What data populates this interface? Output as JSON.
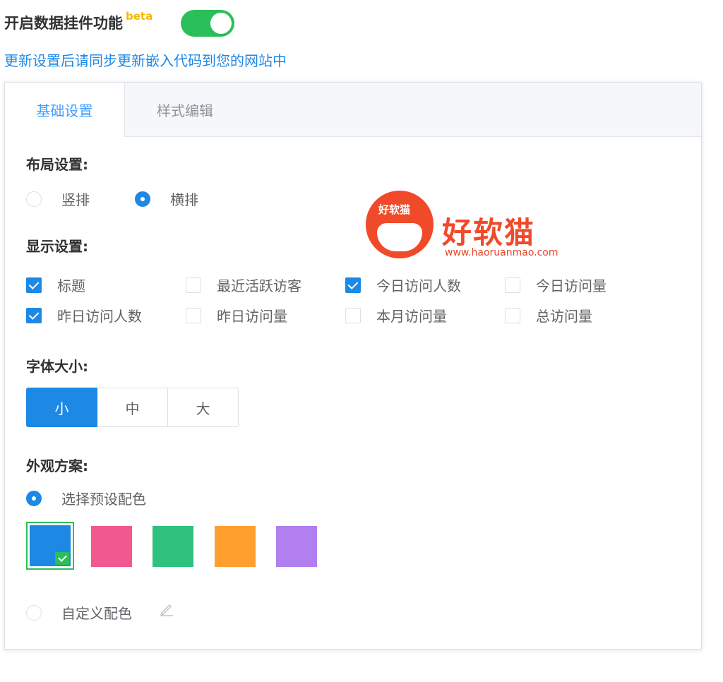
{
  "header": {
    "title": "开启数据挂件功能",
    "badge": "beta",
    "toggle_on": true,
    "sync_note": "更新设置后请同步更新嵌入代码到您的网站中"
  },
  "tabs": [
    {
      "label": "基础设置",
      "active": true
    },
    {
      "label": "样式编辑",
      "active": false
    }
  ],
  "layout": {
    "title": "布局设置:",
    "options": [
      {
        "label": "竖排",
        "checked": false
      },
      {
        "label": "横排",
        "checked": true
      }
    ]
  },
  "display": {
    "title": "显示设置:",
    "items": [
      {
        "label": "标题",
        "checked": true
      },
      {
        "label": "最近活跃访客",
        "checked": false
      },
      {
        "label": "今日访问人数",
        "checked": true
      },
      {
        "label": "今日访问量",
        "checked": false
      },
      {
        "label": "昨日访问人数",
        "checked": true
      },
      {
        "label": "昨日访问量",
        "checked": false
      },
      {
        "label": "本月访问量",
        "checked": false
      },
      {
        "label": "总访问量",
        "checked": false
      }
    ]
  },
  "font_size": {
    "title": "字体大小:",
    "options": [
      "小",
      "中",
      "大"
    ],
    "selected": "小"
  },
  "appearance": {
    "title": "外观方案:",
    "preset_label": "选择预设配色",
    "preset_checked": true,
    "swatches": [
      "#1e88e5",
      "#f0588f",
      "#2ec27e",
      "#ff9f2e",
      "#b17ff0"
    ],
    "selected_swatch": 0,
    "custom_label": "自定义配色",
    "custom_checked": false
  },
  "watermark": {
    "logo_text": "好软猫",
    "brand": "好软猫",
    "url": "www.haoruanmao.com"
  }
}
